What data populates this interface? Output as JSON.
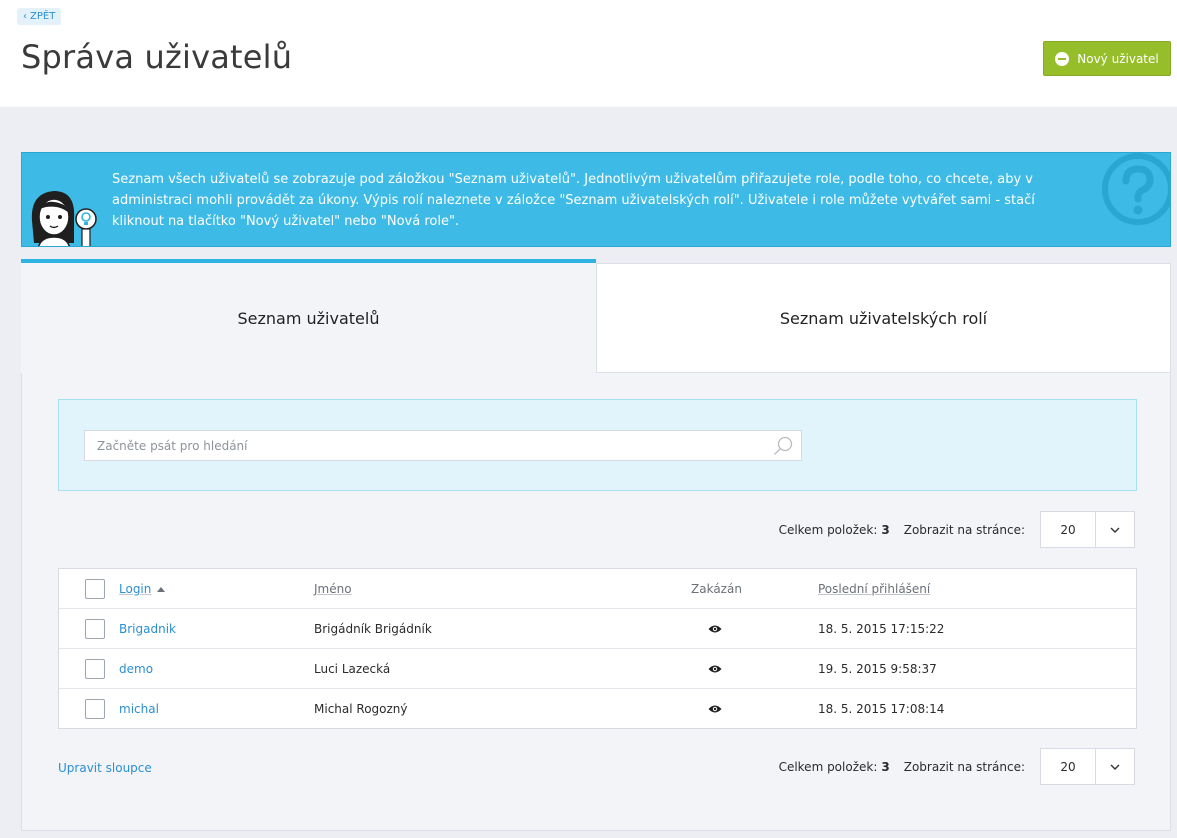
{
  "header": {
    "back_label": "ZPĚT",
    "title": "Správa uživatelů",
    "new_user_label": "Nový uživatel"
  },
  "info": {
    "text": "Seznam všech uživatelů se zobrazuje pod záložkou \"Seznam uživatelů\". Jednotlivým uživatelům přiřazujete role, podle toho, co chcete, aby v administraci mohli provádět za úkony. Výpis rolí naleznete v záložce \"Seznam uživatelských rolí\". Uživatele i role můžete vytvářet sami - stačí kliknout na tlačítko \"Nový uživatel\" nebo \"Nová role\"."
  },
  "tabs": [
    {
      "label": "Seznam uživatelů",
      "active": true
    },
    {
      "label": "Seznam uživatelských rolí",
      "active": false
    }
  ],
  "search": {
    "placeholder": "Začněte psát pro hledání",
    "value": ""
  },
  "pager": {
    "total_label": "Celkem položek:",
    "total_value": "3",
    "per_page_label": "Zobrazit na stránce:",
    "per_page_value": "20"
  },
  "table": {
    "columns": {
      "login": "Login",
      "name": "Jméno",
      "disabled": "Zakázán",
      "last_login": "Poslední přihlášení"
    },
    "rows": [
      {
        "login": "Brigadnik",
        "name": "Brigádník Brigádník",
        "last_login": "18. 5. 2015 17:15:22"
      },
      {
        "login": "demo",
        "name": "Luci Lazecká",
        "last_login": "19. 5. 2015 9:58:37"
      },
      {
        "login": "michal",
        "name": "Michal Rogozný",
        "last_login": "18. 5. 2015 17:08:14"
      }
    ]
  },
  "footer": {
    "edit_columns_label": "Upravit sloupce"
  },
  "colors": {
    "accent_blue": "#2eb3e3",
    "banner": "#3dbbe6",
    "button_green": "#96be2a",
    "link": "#2b8fd1"
  }
}
